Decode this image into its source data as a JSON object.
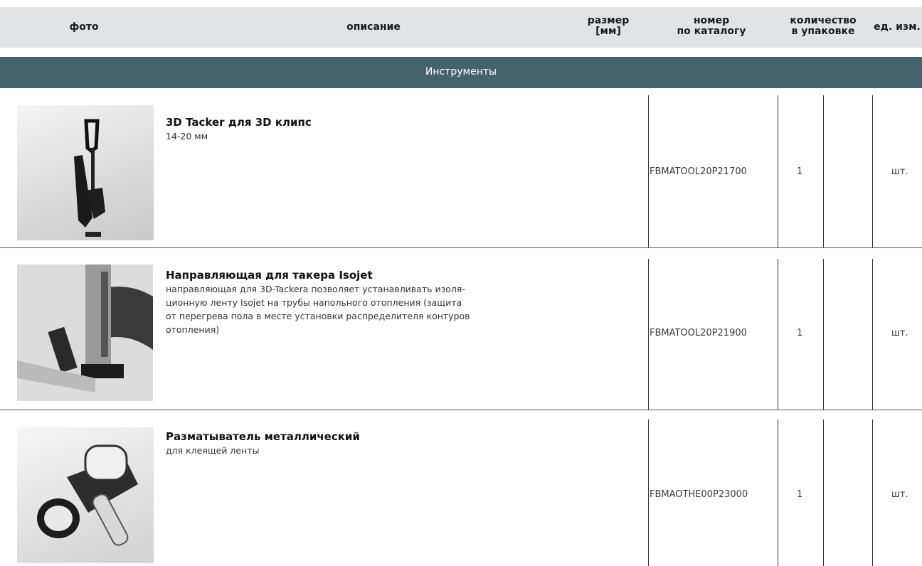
{
  "header": {
    "photo": "фото",
    "description": "описание",
    "size": "размер\n[мм]",
    "catalog_number": "номер\nпо каталогу",
    "quantity": "количество\nв упаковке",
    "unit": "ед. изм."
  },
  "section": {
    "title": "Инструменты"
  },
  "rows": [
    {
      "title": "3D Tacker для 3D клипс",
      "description": "14-20 мм",
      "catalog": "FBMATOOL20P21700",
      "qty": "1",
      "unit": "шт."
    },
    {
      "title": "Направляющая для такера Isojet",
      "description_lines": [
        "направляющая для 3D-Tackera позволяет устанавливать изоля-",
        "ционную ленту Isojet на трубы напольного отопления (защита",
        "от перегрева пола в месте установки распределителя контуров",
        "отопления)"
      ],
      "catalog": "FBMATOOL20P21900",
      "qty": "1",
      "unit": "шт."
    },
    {
      "title": "Разматыватель металлический",
      "description": "для клеящей ленты",
      "catalog": "FBMAOTHE00P23000",
      "qty": "1",
      "unit": "шт."
    }
  ]
}
